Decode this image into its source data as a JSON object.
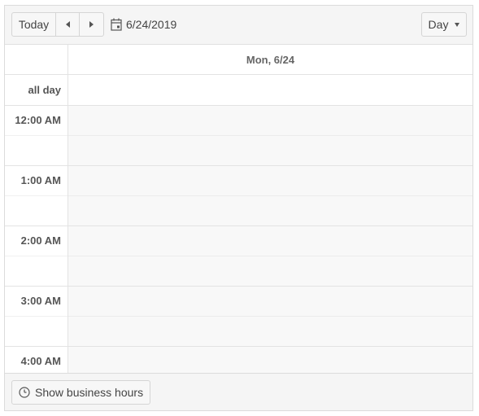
{
  "toolbar": {
    "today_label": "Today",
    "prev_icon": "triangle-left-icon",
    "next_icon": "triangle-right-icon",
    "date_label": "6/24/2019",
    "calendar_icon": "calendar-icon",
    "view_label": "Day"
  },
  "grid": {
    "day_header": "Mon, 6/24",
    "all_day_label": "all day",
    "time_slots": [
      "12:00 AM",
      "1:00 AM",
      "2:00 AM",
      "3:00 AM",
      "4:00 AM"
    ]
  },
  "footer": {
    "business_hours_label": "Show business hours",
    "clock_icon": "clock-icon"
  },
  "colors": {
    "border": "#dcdcdc",
    "toolbar_bg": "#f5f5f5",
    "slot_bg": "#f8f8f8"
  }
}
